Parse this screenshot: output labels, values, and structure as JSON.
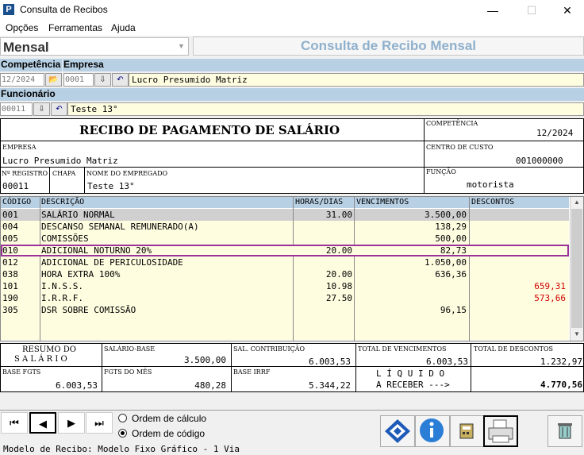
{
  "window": {
    "title": "Consulta de Recibos",
    "app_letter": "P",
    "min": "—",
    "max": "☐",
    "close": "✕"
  },
  "menu": [
    "Opções",
    "Ferramentas",
    "Ajuda"
  ],
  "mode_select": {
    "value": "Mensal",
    "arrow": "▼"
  },
  "page_title": "Consulta de Recibo Mensal",
  "filters": {
    "competencia_label": "Competência",
    "empresa_label": "Empresa",
    "competencia": "12/2024",
    "empresa_code": "0001",
    "empresa_name": "Lucro Presumido Matriz",
    "funcionario_label": "Funcionário",
    "funcionario_code": "00011",
    "funcionario_name": "Teste 13°"
  },
  "receipt": {
    "title": "RECIBO DE PAGAMENTO DE SALÁRIO",
    "competencia_label": "COMPETÊNCIA",
    "competencia": "12/2024",
    "empresa_label": "EMPRESA",
    "empresa": "Lucro Presumido Matriz",
    "centro_label": "CENTRO DE CUSTO",
    "centro": "001000000",
    "registro_label": "Nº REGISTRO",
    "registro": "00011",
    "chapa_label": "CHAPA",
    "chapa": "",
    "nome_label": "NOME DO EMPREGADO",
    "nome": "Teste 13°",
    "funcao_label": "FUNÇÃO",
    "funcao": "motorista"
  },
  "grid": {
    "headers": {
      "codigo": "CÓDIGO",
      "descricao": "DESCRIÇÃO",
      "horas": "HORAS/DIAS",
      "venc": "VENCIMENTOS",
      "desc": "DESCONTOS"
    },
    "rows": [
      {
        "codigo": "001",
        "descricao": "SALÁRIO NORMAL",
        "horas": "31.00",
        "venc": "3.500,00",
        "desc": ""
      },
      {
        "codigo": "004",
        "descricao": "DESCANSO SEMANAL REMUNERADO(A)",
        "horas": "",
        "venc": "138,29",
        "desc": ""
      },
      {
        "codigo": "005",
        "descricao": "COMISSÕES",
        "horas": "",
        "venc": "500,00",
        "desc": ""
      },
      {
        "codigo": "010",
        "descricao": "ADICIONAL NOTURNO  20%",
        "horas": "20.00",
        "venc": "82,73",
        "desc": ""
      },
      {
        "codigo": "012",
        "descricao": "ADICIONAL DE PERICULOSIDADE",
        "horas": "",
        "venc": "1.050,00",
        "desc": ""
      },
      {
        "codigo": "038",
        "descricao": "HORA EXTRA 100%",
        "horas": "20.00",
        "venc": "636,36",
        "desc": ""
      },
      {
        "codigo": "101",
        "descricao": "I.N.S.S.",
        "horas": "10.98",
        "venc": "",
        "desc": "659,31"
      },
      {
        "codigo": "190",
        "descricao": "I.R.R.F.",
        "horas": "27.50",
        "venc": "",
        "desc": "573,66"
      },
      {
        "codigo": "305",
        "descricao": "DSR SOBRE COMISSÃO",
        "horas": "",
        "venc": "96,15",
        "desc": ""
      }
    ],
    "selected_row": 3
  },
  "summary": {
    "resumo_l1": "RESUMO DO",
    "resumo_l2": "S A L Á R I O",
    "salario_base_label": "SALÁRIO-BASE",
    "salario_base": "3.500,00",
    "sal_contrib_label": "SAL. CONTRIBUIÇÃO",
    "sal_contrib": "6.003,53",
    "total_venc_label": "TOTAL DE VENCIMENTOS",
    "total_venc": "6.003,53",
    "total_desc_label": "TOTAL DE DESCONTOS",
    "total_desc": "1.232,97",
    "base_fgts_label": "BASE FGTS",
    "base_fgts": "6.003,53",
    "fgts_mes_label": "FGTS DO MÊS",
    "fgts_mes": "480,28",
    "base_irrf_label": "BASE IRRF",
    "base_irrf": "5.344,22",
    "liquido_l1": "L Í Q U I D O",
    "liquido_l2": "A RECEBER --->",
    "liquido": "4.770,56"
  },
  "nav": {
    "first": "⏮",
    "prev": "◀",
    "next": "▶",
    "last": "⏭"
  },
  "order": {
    "calc": "Ordem de cálculo",
    "code": "Ordem de código",
    "selected": "code"
  },
  "footer": "Modelo de Recibo: Modelo Fixo Gráfico - 1 Via",
  "colors": {
    "header_blue": "#b8d0e4",
    "row_yellow": "#fffde0",
    "selected_border": "#993399",
    "discount_red": "#d00000"
  }
}
